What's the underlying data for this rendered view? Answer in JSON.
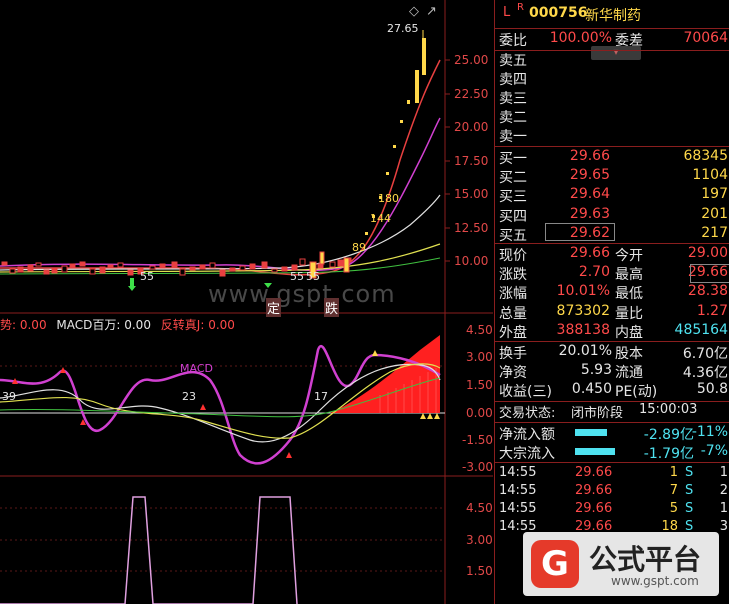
{
  "header": {
    "flag_l": "L",
    "flag_r": "R",
    "code": "000756",
    "name": "新华制药"
  },
  "top_icons": {
    "diamond": "◇",
    "arrow": "↗"
  },
  "ratio": {
    "label1": "委比",
    "value1": "100.00%",
    "label2": "委差",
    "value2": "70064"
  },
  "asks": [
    {
      "label": "卖五"
    },
    {
      "label": "卖四"
    },
    {
      "label": "卖三"
    },
    {
      "label": "卖二"
    },
    {
      "label": "卖一"
    }
  ],
  "bids": [
    {
      "label": "买一",
      "price": "29.66",
      "vol": "68345"
    },
    {
      "label": "买二",
      "price": "29.65",
      "vol": "1104"
    },
    {
      "label": "买三",
      "price": "29.64",
      "vol": "197"
    },
    {
      "label": "买四",
      "price": "29.63",
      "vol": "201"
    },
    {
      "label": "买五",
      "price": "29.62",
      "vol": "217"
    }
  ],
  "quote": [
    {
      "k1": "现价",
      "v1": "29.66",
      "k2": "今开",
      "v2": "29.00",
      "c1": "red",
      "c2": "red"
    },
    {
      "k1": "涨跌",
      "v1": "2.70",
      "k2": "最高",
      "v2": "29.66",
      "c1": "red",
      "c2": "red"
    },
    {
      "k1": "涨幅",
      "v1": "10.01%",
      "k2": "最低",
      "v2": "28.38",
      "c1": "red",
      "c2": "red"
    },
    {
      "k1": "总量",
      "v1": "873302",
      "k2": "量比",
      "v2": "1.27",
      "c1": "yellow",
      "c2": "red"
    },
    {
      "k1": "外盘",
      "v1": "388138",
      "k2": "内盘",
      "v2": "485164",
      "c1": "red",
      "c2": "cyan"
    }
  ],
  "stats": [
    {
      "k1": "换手",
      "v1": "20.01%",
      "k2": "股本",
      "v2": "6.70亿"
    },
    {
      "k1": "净资",
      "v1": "5.93",
      "k2": "流通",
      "v2": "4.36亿"
    },
    {
      "k1": "收益(三)",
      "v1": "0.450",
      "k2": "PE(动)",
      "v2": "50.8"
    }
  ],
  "status": {
    "label": "交易状态:",
    "value": "闭市阶段",
    "time": "15:00:03"
  },
  "flows": [
    {
      "label": "净流入额",
      "value": "-2.89亿",
      "pct": "-11%",
      "bar": 0.72
    },
    {
      "label": "大宗流入",
      "value": "-1.79亿",
      "pct": "-7%",
      "bar": 0.9
    }
  ],
  "trades": [
    {
      "time": "14:55",
      "price": "29.66",
      "vol": "1",
      "side": "S",
      "n": "1"
    },
    {
      "time": "14:55",
      "price": "29.66",
      "vol": "7",
      "side": "S",
      "n": "2"
    },
    {
      "time": "14:55",
      "price": "29.66",
      "vol": "5",
      "side": "S",
      "n": "1"
    },
    {
      "time": "14:55",
      "price": "29.66",
      "vol": "18",
      "side": "S",
      "n": "3"
    }
  ],
  "main_chart": {
    "y_ticks": [
      "25.00",
      "22.50",
      "20.00",
      "17.50",
      "15.00",
      "12.50",
      "10.00"
    ],
    "high_label": "27.65",
    "ma_labels": [
      "180",
      "144",
      "89",
      "55",
      "55",
      "55"
    ],
    "watermark": "www.gspt.com",
    "markers": [
      "定",
      "跌"
    ]
  },
  "macd_chart": {
    "legend_a": "势: 0.00",
    "legend_b": "MACD百万: 0.00",
    "legend_c": "反转真J: 0.00",
    "y_ticks": [
      "4.50",
      "3.00",
      "1.50",
      "0.00",
      "-1.50",
      "-3.00"
    ],
    "labels": [
      "39",
      "MACD",
      "23",
      "17"
    ]
  },
  "bottom_chart": {
    "y_ticks": [
      "4.50",
      "3.00",
      "1.50"
    ]
  },
  "badge": {
    "title": "公式平台",
    "url": "www.gspt.com",
    "logo": "G"
  },
  "colors": {
    "red": "#ff4a4a",
    "green": "#3ee04a",
    "grid": "#8a1e1e",
    "magenta": "#e040e0",
    "yellow": "#ffd84a"
  }
}
